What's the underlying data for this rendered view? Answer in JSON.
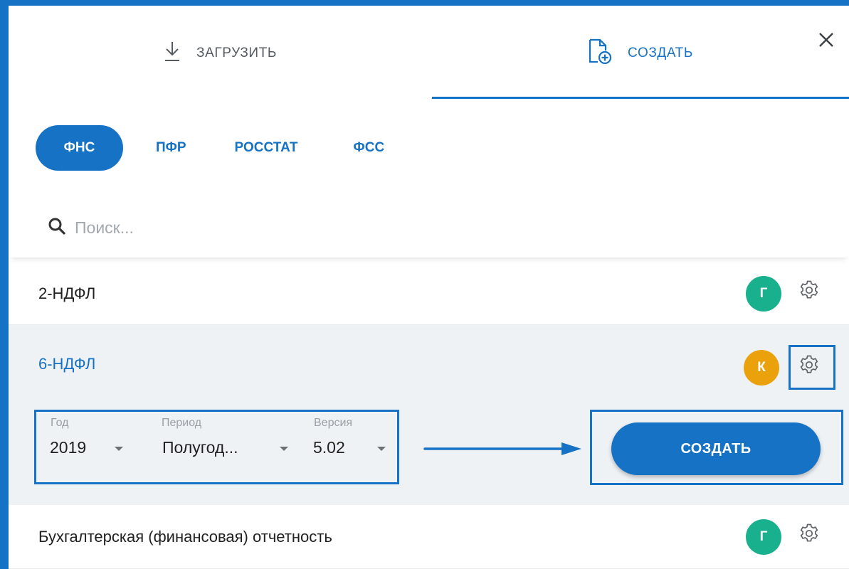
{
  "tabs": [
    {
      "label": "ЗАГРУЗИТЬ",
      "icon": "download-icon",
      "active": false
    },
    {
      "label": "СОЗДАТЬ",
      "icon": "file-add-icon",
      "active": true
    }
  ],
  "close_icon": "close-icon",
  "filters": [
    {
      "label": "ФНС",
      "active": true
    },
    {
      "label": "ПФР",
      "active": false
    },
    {
      "label": "РОССТАТ",
      "active": false
    },
    {
      "label": "ФСС",
      "active": false
    }
  ],
  "search": {
    "placeholder": "Поиск...",
    "value": "",
    "icon": "search-icon"
  },
  "reports": [
    {
      "title": "2-НДФЛ",
      "badge": "Г",
      "badge_color": "#18b08d",
      "expanded": false
    },
    {
      "title": "6-НДФЛ",
      "badge": "К",
      "badge_color": "#eba10c",
      "expanded": true
    },
    {
      "title": "Бухгалтерская (финансовая) отчетность",
      "badge": "Г",
      "badge_color": "#18b08d",
      "expanded": false
    }
  ],
  "expanded": {
    "fields": {
      "year": {
        "label": "Год",
        "value": "2019"
      },
      "period": {
        "label": "Период",
        "value": "Полугод..."
      },
      "version": {
        "label": "Версия",
        "value": "5.02"
      }
    },
    "create_button": "СОЗДАТЬ"
  },
  "colors": {
    "accent": "#1672c4",
    "badge_green": "#18b08d",
    "badge_orange": "#eba10c",
    "expanded_bg": "#eff2f5"
  }
}
